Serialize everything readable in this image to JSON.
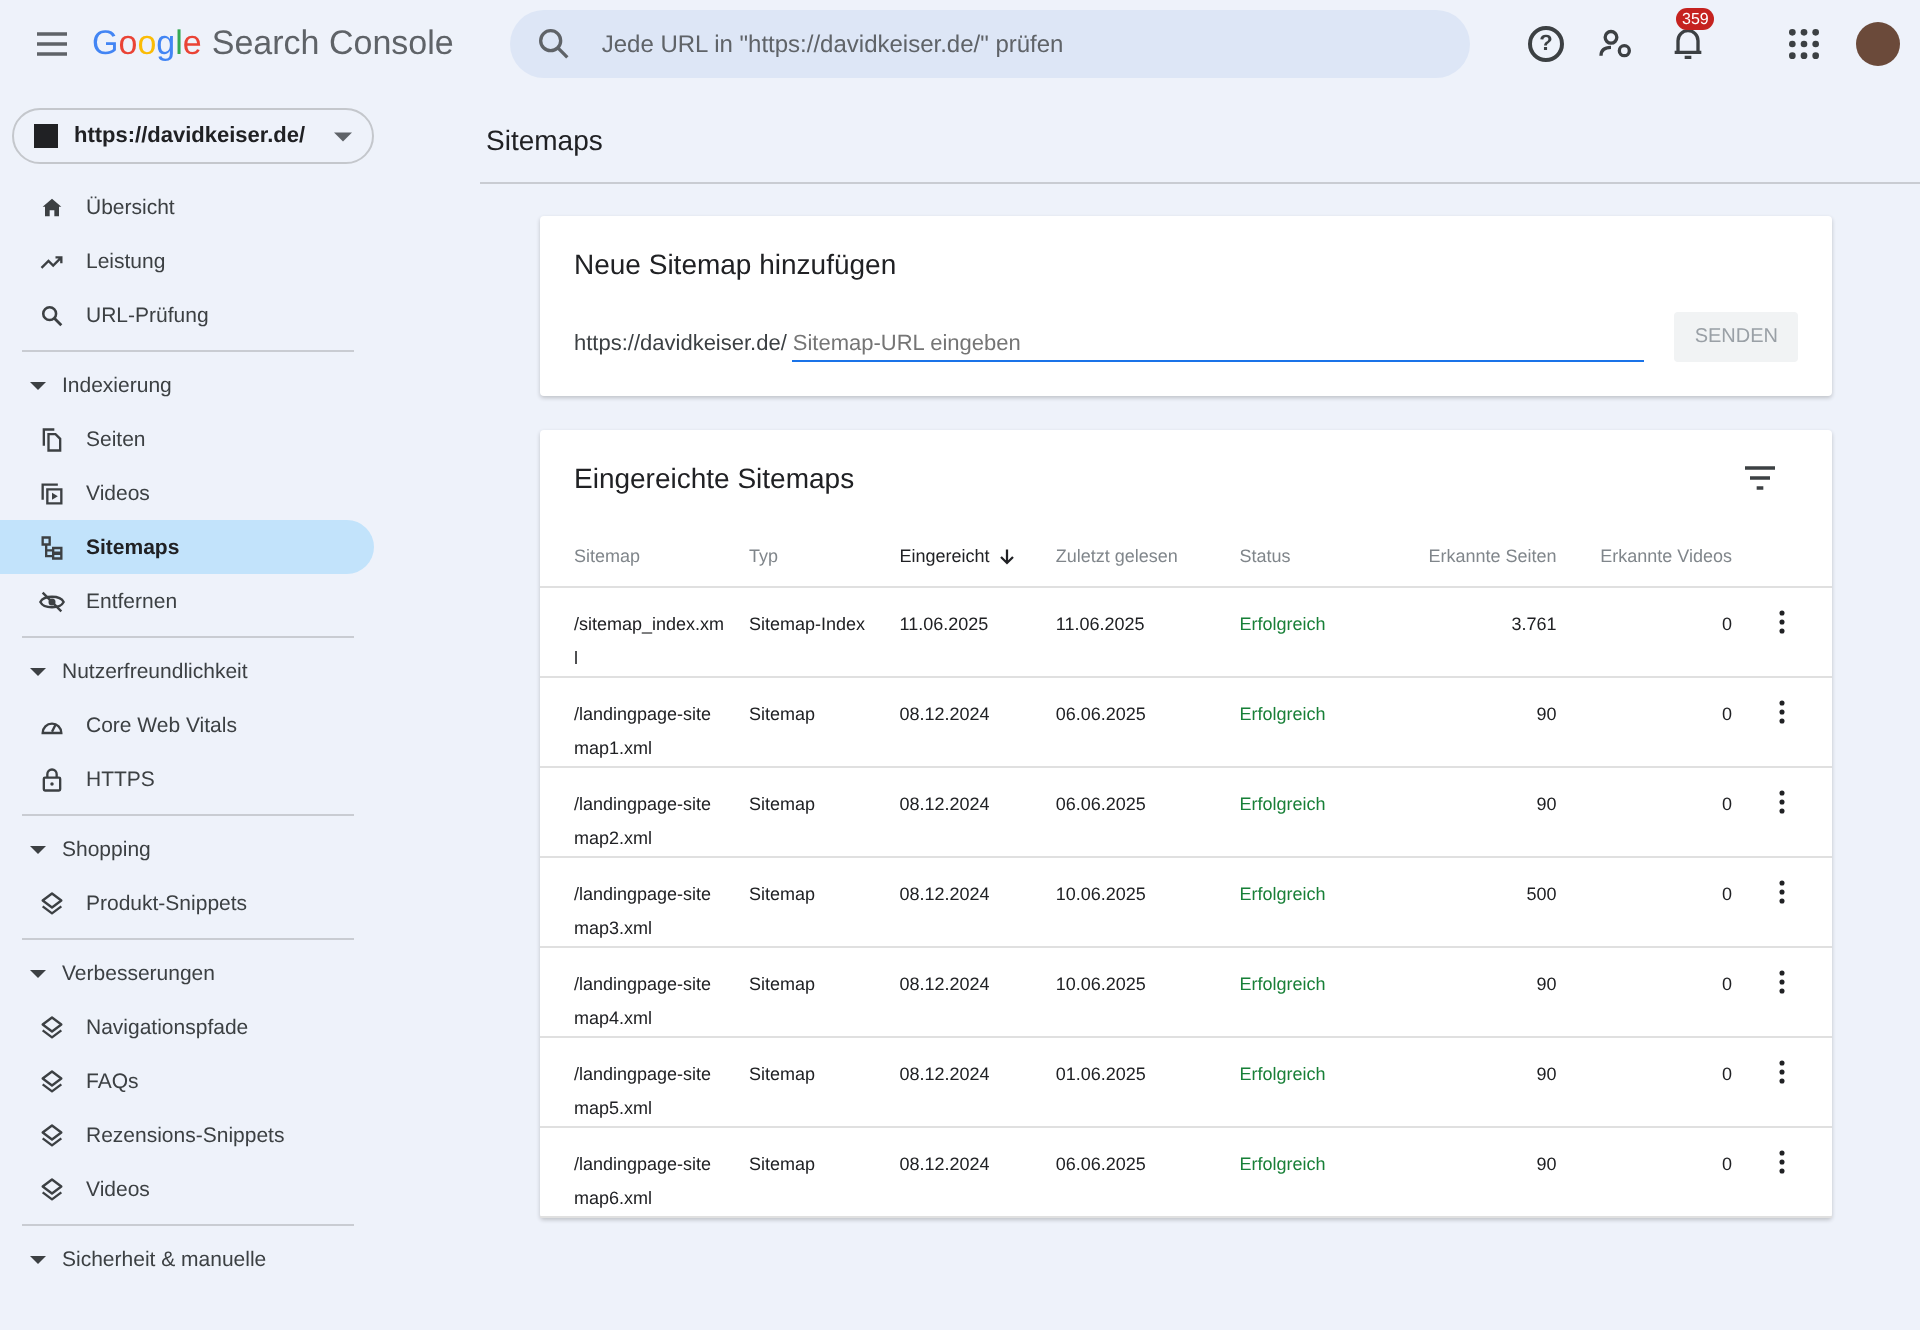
{
  "header": {
    "logo": "Google",
    "product": "Search Console",
    "search": {
      "placeholder": "Jede URL in \"https://davidkeiser.de/\" prüfen"
    },
    "help": "?",
    "notification_count": "359"
  },
  "property": {
    "label": "https://davidkeiser.de/"
  },
  "sidebar": {
    "main_items": [
      {
        "label": "Übersicht",
        "selected": false
      },
      {
        "label": "Leistung",
        "selected": false
      },
      {
        "label": "URL-Prüfung",
        "selected": false
      }
    ],
    "sections": [
      {
        "title": "Indexierung",
        "items": [
          {
            "label": "Seiten",
            "selected": false
          },
          {
            "label": "Videos",
            "selected": false
          },
          {
            "label": "Sitemaps",
            "selected": true
          },
          {
            "label": "Entfernen",
            "selected": false
          }
        ]
      },
      {
        "title": "Nutzerfreundlichkeit",
        "items": [
          {
            "label": "Core Web Vitals",
            "selected": false
          },
          {
            "label": "HTTPS",
            "selected": false
          }
        ]
      },
      {
        "title": "Shopping",
        "items": [
          {
            "label": "Produkt-Snippets",
            "selected": false
          }
        ]
      },
      {
        "title": "Verbesserungen",
        "items": [
          {
            "label": "Navigationspfade",
            "selected": false
          },
          {
            "label": "FAQs",
            "selected": false
          },
          {
            "label": "Rezensions-Snippets",
            "selected": false
          },
          {
            "label": "Videos",
            "selected": false
          }
        ]
      },
      {
        "title": "Sicherheit & manuelle"
      }
    ]
  },
  "page_title": "Sitemaps",
  "add_card": {
    "title": "Neue Sitemap hinzufügen",
    "prefix": "https://davidkeiser.de/",
    "placeholder": "Sitemap-URL eingeben",
    "button": "SENDEN",
    "button_disabled": true
  },
  "table": {
    "title": "Eingereichte Sitemaps",
    "columns": [
      {
        "label": "Sitemap",
        "sorted": false
      },
      {
        "label": "Typ",
        "sorted": false
      },
      {
        "label": "Eingereicht",
        "sorted": true
      },
      {
        "label": "Zuletzt gelesen",
        "sorted": false
      },
      {
        "label": "Status",
        "sorted": false
      },
      {
        "label": "Erkannte Seiten",
        "sorted": false
      },
      {
        "label": "Erkannte Videos",
        "sorted": false
      }
    ],
    "rows": [
      {
        "cells": [
          "/sitemap_index.xml",
          "Sitemap-Index",
          "11.06.2025",
          "11.06.2025",
          "Erfolgreich",
          "3.761",
          "0"
        ]
      },
      {
        "cells": [
          "/landingpage-sitemap1.xml",
          "Sitemap",
          "08.12.2024",
          "06.06.2025",
          "Erfolgreich",
          "90",
          "0"
        ]
      },
      {
        "cells": [
          "/landingpage-sitemap2.xml",
          "Sitemap",
          "08.12.2024",
          "06.06.2025",
          "Erfolgreich",
          "90",
          "0"
        ]
      },
      {
        "cells": [
          "/landingpage-sitemap3.xml",
          "Sitemap",
          "08.12.2024",
          "10.06.2025",
          "Erfolgreich",
          "500",
          "0"
        ]
      },
      {
        "cells": [
          "/landingpage-sitemap4.xml",
          "Sitemap",
          "08.12.2024",
          "10.06.2025",
          "Erfolgreich",
          "90",
          "0"
        ]
      },
      {
        "cells": [
          "/landingpage-sitemap5.xml",
          "Sitemap",
          "08.12.2024",
          "01.06.2025",
          "Erfolgreich",
          "90",
          "0"
        ]
      },
      {
        "cells": [
          "/landingpage-sitemap6.xml",
          "Sitemap",
          "08.12.2024",
          "06.06.2025",
          "Erfolgreich",
          "90",
          "0"
        ]
      }
    ]
  }
}
